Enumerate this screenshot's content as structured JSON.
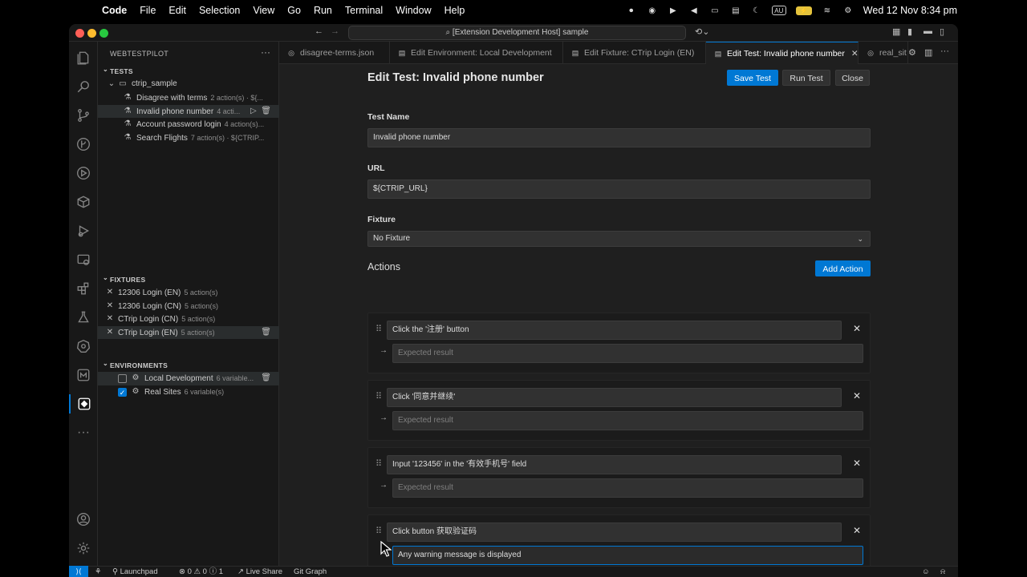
{
  "menubar": {
    "app": "Code",
    "items": [
      "File",
      "Edit",
      "Selection",
      "View",
      "Go",
      "Run",
      "Terminal",
      "Window",
      "Help"
    ],
    "keyboard": "AU",
    "clock": "Wed 12 Nov  8:34 pm"
  },
  "window": {
    "command_center": "[Extension Development Host] sample"
  },
  "sidebar": {
    "title": "WEBTESTPILOT",
    "tests_header": "TESTS",
    "folder": "ctrip_sample",
    "tests": [
      {
        "name": "Disagree with terms",
        "meta": "2 action(s) · ${..."
      },
      {
        "name": "Invalid phone number",
        "meta": "4 acti..."
      },
      {
        "name": "Account password login",
        "meta": "4 action(s)..."
      },
      {
        "name": "Search Flights",
        "meta": "7 action(s) · ${CTRIP..."
      }
    ],
    "fixtures_header": "FIXTURES",
    "fixtures": [
      {
        "name": "12306 Login (EN)",
        "meta": "5 action(s)"
      },
      {
        "name": "12306 Login (CN)",
        "meta": "5 action(s)"
      },
      {
        "name": "CTrip Login (CN)",
        "meta": "5 action(s)"
      },
      {
        "name": "CTrip Login (EN)",
        "meta": "5 action(s)"
      }
    ],
    "environments_header": "ENVIRONMENTS",
    "environments": [
      {
        "name": "Local Development",
        "meta": "6 variable...",
        "checked": false
      },
      {
        "name": "Real Sites",
        "meta": "6 variable(s)",
        "checked": true
      }
    ]
  },
  "tabs": [
    {
      "label": "disagree-terms.json"
    },
    {
      "label": "Edit Environment: Local Development"
    },
    {
      "label": "Edit Fixture: CTrip Login (EN)"
    },
    {
      "label": "Edit Test: Invalid phone number"
    },
    {
      "label": "real_sit"
    }
  ],
  "editor": {
    "title": "Edit Test: Invalid phone number",
    "save_label": "Save Test",
    "run_label": "Run Test",
    "close_label": "Close",
    "name_label": "Test Name",
    "name_value": "Invalid phone number",
    "url_label": "URL",
    "url_value": "${CTRIP_URL}",
    "fixture_label": "Fixture",
    "fixture_value": "No Fixture",
    "actions_label": "Actions",
    "add_action_label": "Add Action",
    "expected_placeholder": "Expected result",
    "actions": [
      {
        "action": "Click the '注册' button",
        "expected": ""
      },
      {
        "action": "Click '同意并继续'",
        "expected": ""
      },
      {
        "action": "Input '123456' in the '有效手机号' field",
        "expected": ""
      },
      {
        "action": "Click button 获取验证码",
        "expected": "Any warning message is displayed"
      }
    ]
  },
  "statusbar": {
    "launchpad": "Launchpad",
    "problems": "⊗ 0 ⚠ 0 ⓘ 1",
    "liveshare": "Live Share",
    "gitgraph": "Git Graph"
  },
  "colors": {
    "accent": "#0078d4",
    "editor_bg": "#1f1f1f",
    "sidebar_bg": "#181818"
  }
}
